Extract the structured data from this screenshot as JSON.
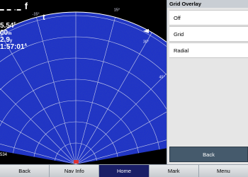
{
  "readouts": {
    "speed": "5.54",
    "speed_unit": "F",
    "range": "00",
    "range_unit": "m",
    "depth": "2.9",
    "depth_unit": "y",
    "time": "1:57:01",
    "time_unit": "A",
    "track_label": "f",
    "track_sub": "t",
    "bottom_value": "534"
  },
  "bearing_labels": [
    "-15",
    "15",
    "30",
    "45",
    "60",
    "75"
  ],
  "grid_overlay": {
    "title": "Grid Overlay",
    "options": [
      "Off",
      "Grid",
      "Radial"
    ],
    "back_label": "Back"
  },
  "softkeys": [
    {
      "label": "Back",
      "active": false
    },
    {
      "label": "Nav Info",
      "active": false
    },
    {
      "label": "Home",
      "active": true
    },
    {
      "label": "Mark",
      "active": false
    },
    {
      "label": "Menu",
      "active": false
    }
  ],
  "colors": {
    "sonar_blue": "#1f33c8",
    "grid_line": "#c7ccea",
    "softkey_active": "#1a1f66",
    "back_button": "#455a6c"
  }
}
